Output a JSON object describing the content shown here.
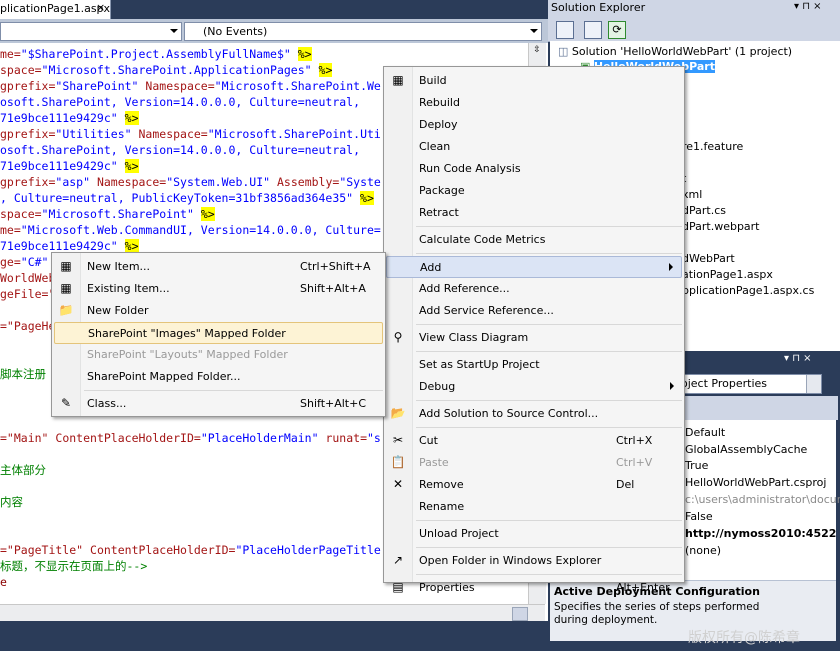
{
  "editor": {
    "tab_label": "plicationPage1.aspx",
    "tab_close": "×",
    "left_dropdown": "",
    "right_dropdown": "(No Events)",
    "lines": [
      [
        [
          "r",
          "me="
        ],
        [
          "b",
          "\"$SharePoint.Project.AssemblyFullName$\""
        ],
        [
          "k",
          " "
        ],
        [
          "hl",
          "%>"
        ]
      ],
      [
        [
          "r",
          "space="
        ],
        [
          "b",
          "\"Microsoft.SharePoint.ApplicationPages\""
        ],
        [
          "k",
          " "
        ],
        [
          "hl",
          "%>"
        ]
      ],
      [
        [
          "r",
          "gprefix="
        ],
        [
          "b",
          "\"SharePoint\""
        ],
        [
          "k",
          " "
        ],
        [
          "r",
          "Namespace="
        ],
        [
          "b",
          "\"Microsoft.SharePoint.We"
        ]
      ],
      [
        [
          "b",
          "osoft.SharePoint, Version=14.0.0.0, Culture=neutral,"
        ]
      ],
      [
        [
          "b",
          "71e9bce111e9429c\""
        ],
        [
          "k",
          " "
        ],
        [
          "hl",
          "%>"
        ]
      ],
      [
        [
          "r",
          "gprefix="
        ],
        [
          "b",
          "\"Utilities\""
        ],
        [
          "k",
          " "
        ],
        [
          "r",
          "Namespace="
        ],
        [
          "b",
          "\"Microsoft.SharePoint.Uti"
        ]
      ],
      [
        [
          "b",
          "osoft.SharePoint, Version=14.0.0.0, Culture=neutral,"
        ]
      ],
      [
        [
          "b",
          "71e9bce111e9429c\""
        ],
        [
          "k",
          " "
        ],
        [
          "hl",
          "%>"
        ]
      ],
      [
        [
          "r",
          "gprefix="
        ],
        [
          "b",
          "\"asp\""
        ],
        [
          "k",
          " "
        ],
        [
          "r",
          "Namespace="
        ],
        [
          "b",
          "\"System.Web.UI\""
        ],
        [
          "k",
          " "
        ],
        [
          "r",
          "Assembly="
        ],
        [
          "b",
          "\"Syste"
        ]
      ],
      [
        [
          "b",
          ", Culture=neutral, PublicKeyToken=31bf3856ad364e35\""
        ],
        [
          "k",
          " "
        ],
        [
          "hl",
          "%>"
        ]
      ],
      [
        [
          "r",
          "space="
        ],
        [
          "b",
          "\"Microsoft.SharePoint\""
        ],
        [
          "k",
          " "
        ],
        [
          "hl",
          "%>"
        ]
      ],
      [
        [
          "r",
          "me="
        ],
        [
          "b",
          "\"Microsoft.Web.CommandUI, Version=14.0.0.0, Culture="
        ]
      ],
      [
        [
          "b",
          "71e9bce111e9429c\""
        ],
        [
          "k",
          " "
        ],
        [
          "hl",
          "%>"
        ]
      ],
      [
        [
          "r",
          "ge="
        ],
        [
          "b",
          "\"C#\""
        ]
      ],
      [
        [
          "r",
          "WorldWeb"
        ]
      ],
      [
        [
          "r",
          "geFile=\""
        ]
      ],
      [
        [
          "k",
          ""
        ]
      ],
      [
        [
          "r",
          "=\"PageHe"
        ]
      ],
      [
        [
          "k",
          ""
        ]
      ],
      [
        [
          "k",
          ""
        ]
      ],
      [
        [
          "g",
          "脚本注册"
        ]
      ],
      [
        [
          "k",
          ""
        ]
      ],
      [
        [
          "k",
          ""
        ]
      ],
      [
        [
          "k",
          ""
        ]
      ],
      [
        [
          "r",
          "=\"Main\""
        ],
        [
          "k",
          " "
        ],
        [
          "r",
          "ContentPlaceHolderID="
        ],
        [
          "b",
          "\"PlaceHolderMain\""
        ],
        [
          "k",
          " "
        ],
        [
          "r",
          "runat="
        ],
        [
          "b",
          "\"s"
        ]
      ],
      [
        [
          "k",
          ""
        ]
      ],
      [
        [
          "g",
          "主体部分"
        ]
      ],
      [
        [
          "k",
          ""
        ]
      ],
      [
        [
          "g",
          "内容"
        ]
      ],
      [
        [
          "k",
          ""
        ]
      ],
      [
        [
          "k",
          ""
        ]
      ],
      [
        [
          "r",
          "=\"PageTitle\""
        ],
        [
          "k",
          " "
        ],
        [
          "r",
          "ContentPlaceHolderID="
        ],
        [
          "b",
          "\"PlaceHolderPageTitle"
        ]
      ],
      [
        [
          "g",
          "标题，不显示在页面上的-->"
        ]
      ],
      [
        [
          "m",
          "e"
        ]
      ]
    ]
  },
  "solution_explorer": {
    "title": "Solution Explorer",
    "pin": "▾ ⊓ ×",
    "tree": [
      {
        "label": "Solution 'HelloWorldWebPart' (1 project)",
        "indent": 0
      },
      {
        "label": "HelloWorldWebPart",
        "indent": 1,
        "selected": true
      },
      {
        "label": "re1.feature",
        "indent": 4
      },
      {
        "label": "t",
        "indent": 4
      },
      {
        "label": "xml",
        "indent": 4
      },
      {
        "label": "dPart.cs",
        "indent": 4
      },
      {
        "label": "dPart.webpart",
        "indent": 4
      },
      {
        "label": "dWebPart",
        "indent": 4
      },
      {
        "label": "ationPage1.aspx",
        "indent": 4
      },
      {
        "label": "pplicationPage1.aspx.cs",
        "indent": 4
      }
    ]
  },
  "properties": {
    "combo": "oject Properties",
    "title_buttons": "▾ ⊓ ×",
    "values": [
      "Default",
      "GlobalAssemblyCache",
      "True",
      "HelloWorldWebPart.csproj",
      "c:\\users\\administrator\\docum",
      "False",
      "http://nymoss2010:4522",
      "(none)"
    ],
    "desc_title": "Active Deployment Configuration",
    "desc_text": "Specifies the series of steps performed during deployment."
  },
  "project_menu": {
    "items": [
      {
        "label": "Build",
        "icon": "build-icon",
        "glyph": "▦"
      },
      {
        "label": "Rebuild"
      },
      {
        "label": "Deploy"
      },
      {
        "label": "Clean"
      },
      {
        "label": "Run Code Analysis"
      },
      {
        "label": "Package"
      },
      {
        "label": "Retract"
      },
      {
        "sep": true
      },
      {
        "label": "Calculate Code Metrics"
      },
      {
        "sep": true
      },
      {
        "label": "Add",
        "submenu": true,
        "highlight": true
      },
      {
        "label": "Add Reference..."
      },
      {
        "label": "Add Service Reference..."
      },
      {
        "sep": true
      },
      {
        "label": "View Class Diagram",
        "icon": "class-diagram-icon",
        "glyph": "⚲"
      },
      {
        "sep": true
      },
      {
        "label": "Set as StartUp Project"
      },
      {
        "label": "Debug",
        "submenu": true
      },
      {
        "sep": true
      },
      {
        "label": "Add Solution to Source Control...",
        "icon": "source-control-icon",
        "glyph": "📂"
      },
      {
        "sep": true
      },
      {
        "label": "Cut",
        "shortcut": "Ctrl+X",
        "icon": "cut-icon",
        "glyph": "✂"
      },
      {
        "label": "Paste",
        "shortcut": "Ctrl+V",
        "disabled": true,
        "icon": "paste-icon",
        "glyph": "📋"
      },
      {
        "label": "Remove",
        "shortcut": "Del",
        "icon": "remove-icon",
        "glyph": "✕"
      },
      {
        "label": "Rename"
      },
      {
        "sep": true
      },
      {
        "label": "Unload Project"
      },
      {
        "sep": true
      },
      {
        "label": "Open Folder in Windows Explorer",
        "icon": "open-folder-icon",
        "glyph": "↗"
      },
      {
        "sep": true
      },
      {
        "label": "Properties",
        "shortcut": "Alt+Enter",
        "icon": "properties-icon",
        "glyph": "▤"
      }
    ]
  },
  "add_menu": {
    "items": [
      {
        "label": "New Item...",
        "shortcut": "Ctrl+Shift+A",
        "icon": "new-item-icon",
        "glyph": "▦"
      },
      {
        "label": "Existing Item...",
        "shortcut": "Shift+Alt+A",
        "icon": "existing-item-icon",
        "glyph": "▦"
      },
      {
        "label": "New Folder",
        "icon": "new-folder-icon",
        "glyph": "📁"
      },
      {
        "label": "SharePoint \"Images\" Mapped Folder",
        "highlight": true
      },
      {
        "label": "SharePoint \"Layouts\" Mapped Folder",
        "disabled": true
      },
      {
        "label": "SharePoint Mapped Folder..."
      },
      {
        "sep": true
      },
      {
        "label": "Class...",
        "shortcut": "Shift+Alt+C",
        "icon": "class-icon",
        "glyph": "✎"
      }
    ]
  },
  "watermark": "版权所有@陈希章",
  "colors": {
    "menu_highlight": "#fdf3d5",
    "vs_frame": "#2b3c59",
    "code_highlight": "#ffff00"
  }
}
